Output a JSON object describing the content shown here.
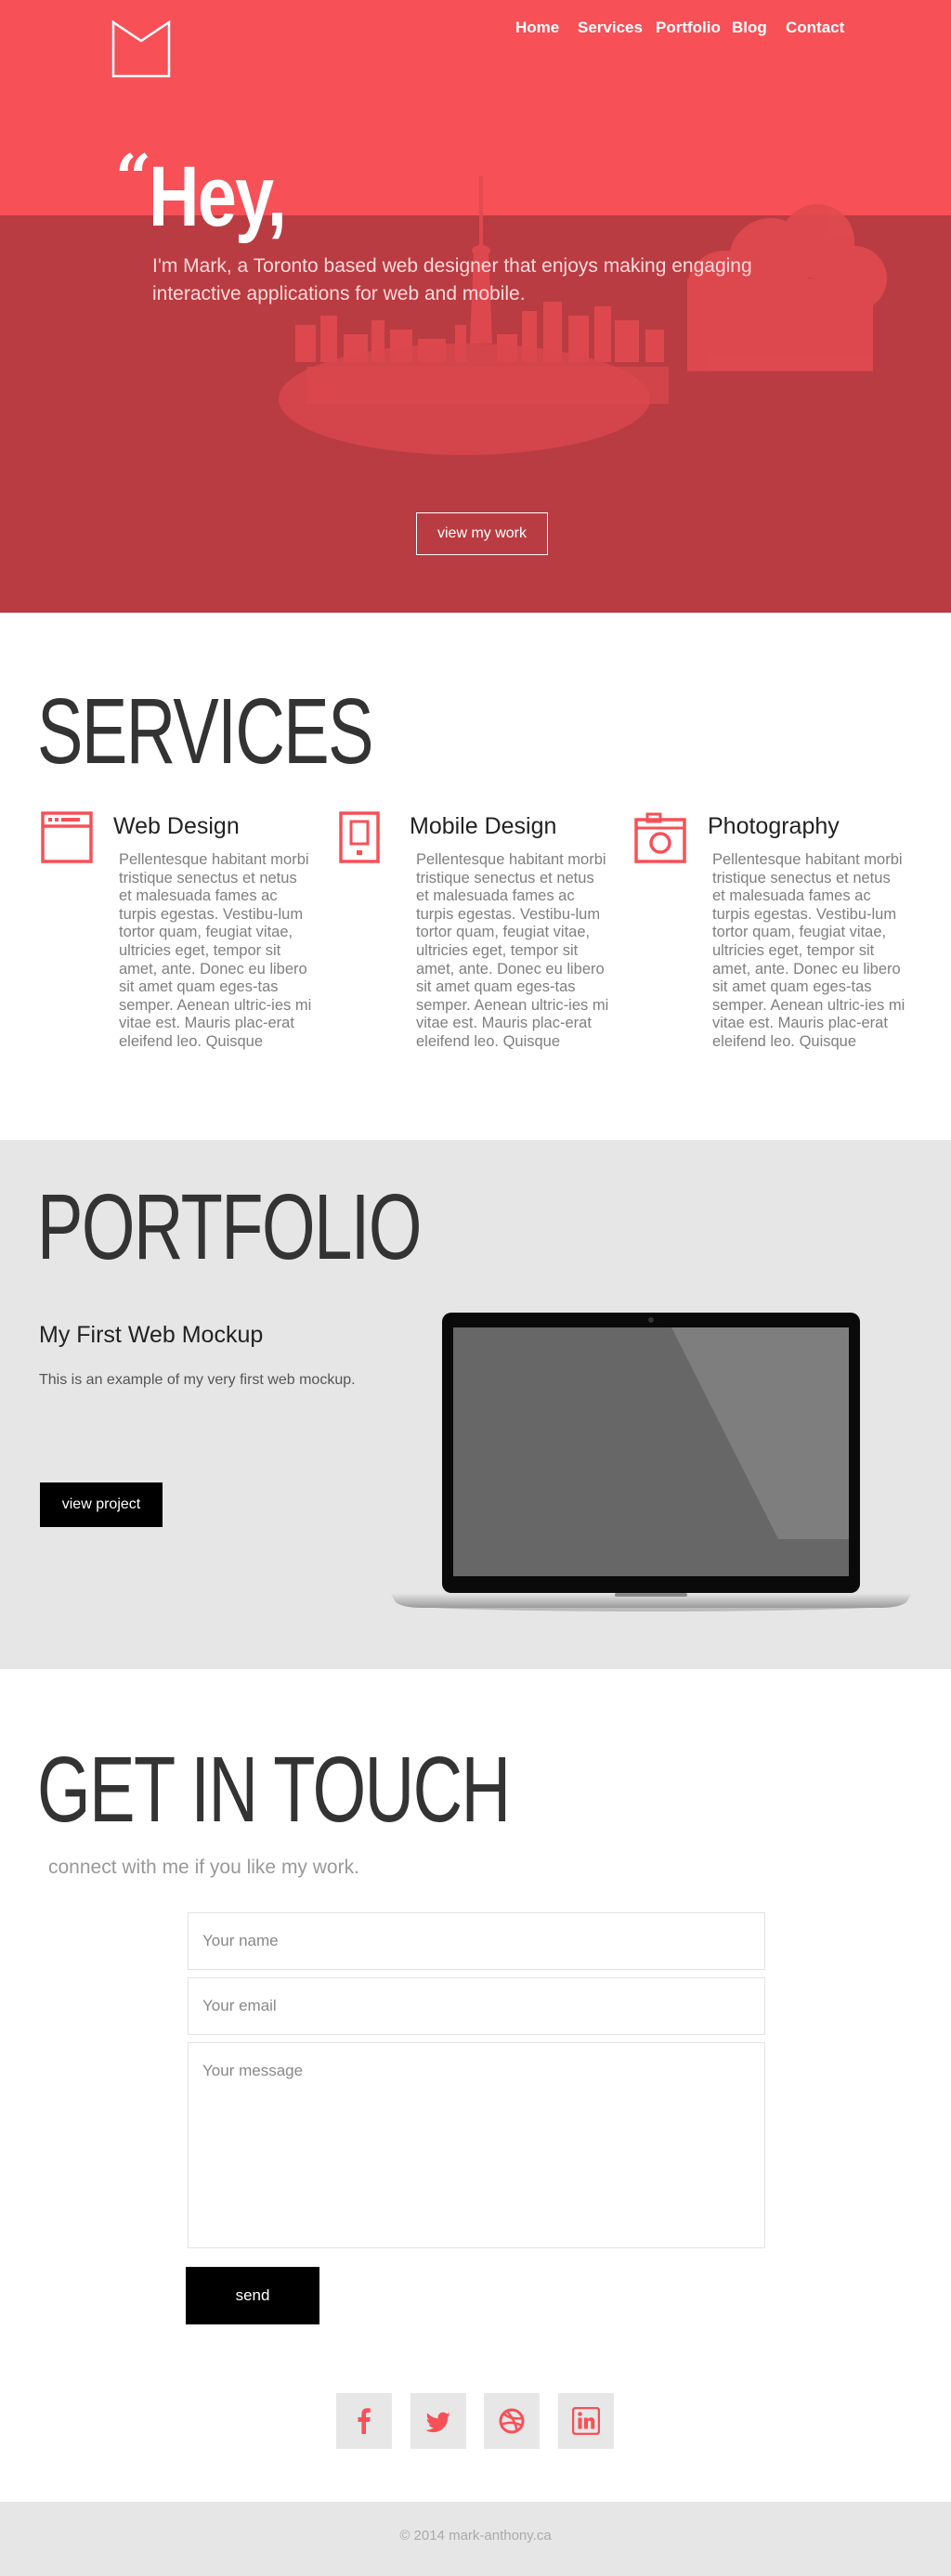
{
  "nav": {
    "items": [
      {
        "label": "Home"
      },
      {
        "label": "Services"
      },
      {
        "label": "Portfolio"
      },
      {
        "label": "Blog"
      },
      {
        "label": "Contact"
      }
    ]
  },
  "hero": {
    "quote": "“",
    "title": "Hey,",
    "text": "I'm Mark, a Toronto based web designer that enjoys making engaging interactive applications for web and mobile.",
    "button": "view my work"
  },
  "services": {
    "title": "SERVICES",
    "items": [
      {
        "icon": "browser-window-icon",
        "name": "Web Design",
        "desc": "Pellentesque habitant morbi tristique senectus et netus et malesuada fames ac turpis egestas. Vestibu-lum tortor quam, feugiat vitae, ultricies eget, tempor sit amet, ante. Donec eu libero sit amet quam eges-tas semper. Aenean ultric-ies mi vitae est. Mauris plac-erat eleifend leo. Quisque"
      },
      {
        "icon": "mobile-phone-icon",
        "name": "Mobile Design",
        "desc": "Pellentesque habitant morbi tristique senectus et netus et malesuada fames ac turpis egestas. Vestibu-lum tortor quam, feugiat vitae, ultricies eget, tempor sit amet, ante. Donec eu libero sit amet quam eges-tas semper. Aenean ultric-ies mi vitae est. Mauris plac-erat eleifend leo. Quisque"
      },
      {
        "icon": "camera-icon",
        "name": "Photography",
        "desc": "Pellentesque habitant morbi tristique senectus et netus et malesuada fames ac turpis egestas. Vestibu-lum tortor quam, feugiat vitae, ultricies eget, tempor sit amet, ante. Donec eu libero sit amet quam eges-tas semper. Aenean ultric-ies mi vitae est. Mauris plac-erat eleifend leo. Quisque"
      }
    ]
  },
  "portfolio": {
    "title": "PORTFOLIO",
    "project_title": "My First Web Mockup",
    "project_desc": "This is an example of my very first web mockup.",
    "button": "view project"
  },
  "contact": {
    "title": "GET IN TOUCH",
    "subtitle": "connect with me if you like my work.",
    "name_placeholder": "Your name",
    "email_placeholder": "Your email",
    "message_placeholder": "Your message",
    "send_label": "send"
  },
  "social": [
    {
      "icon": "facebook-icon"
    },
    {
      "icon": "twitter-icon"
    },
    {
      "icon": "dribbble-icon"
    },
    {
      "icon": "linkedin-icon"
    }
  ],
  "footer": {
    "text": "© 2014 mark-anthony.ca"
  },
  "colors": {
    "brand": "#f75057",
    "brand_dark": "#b93c42",
    "gray_bg": "#e6e6e6",
    "text_dark": "#333333"
  }
}
